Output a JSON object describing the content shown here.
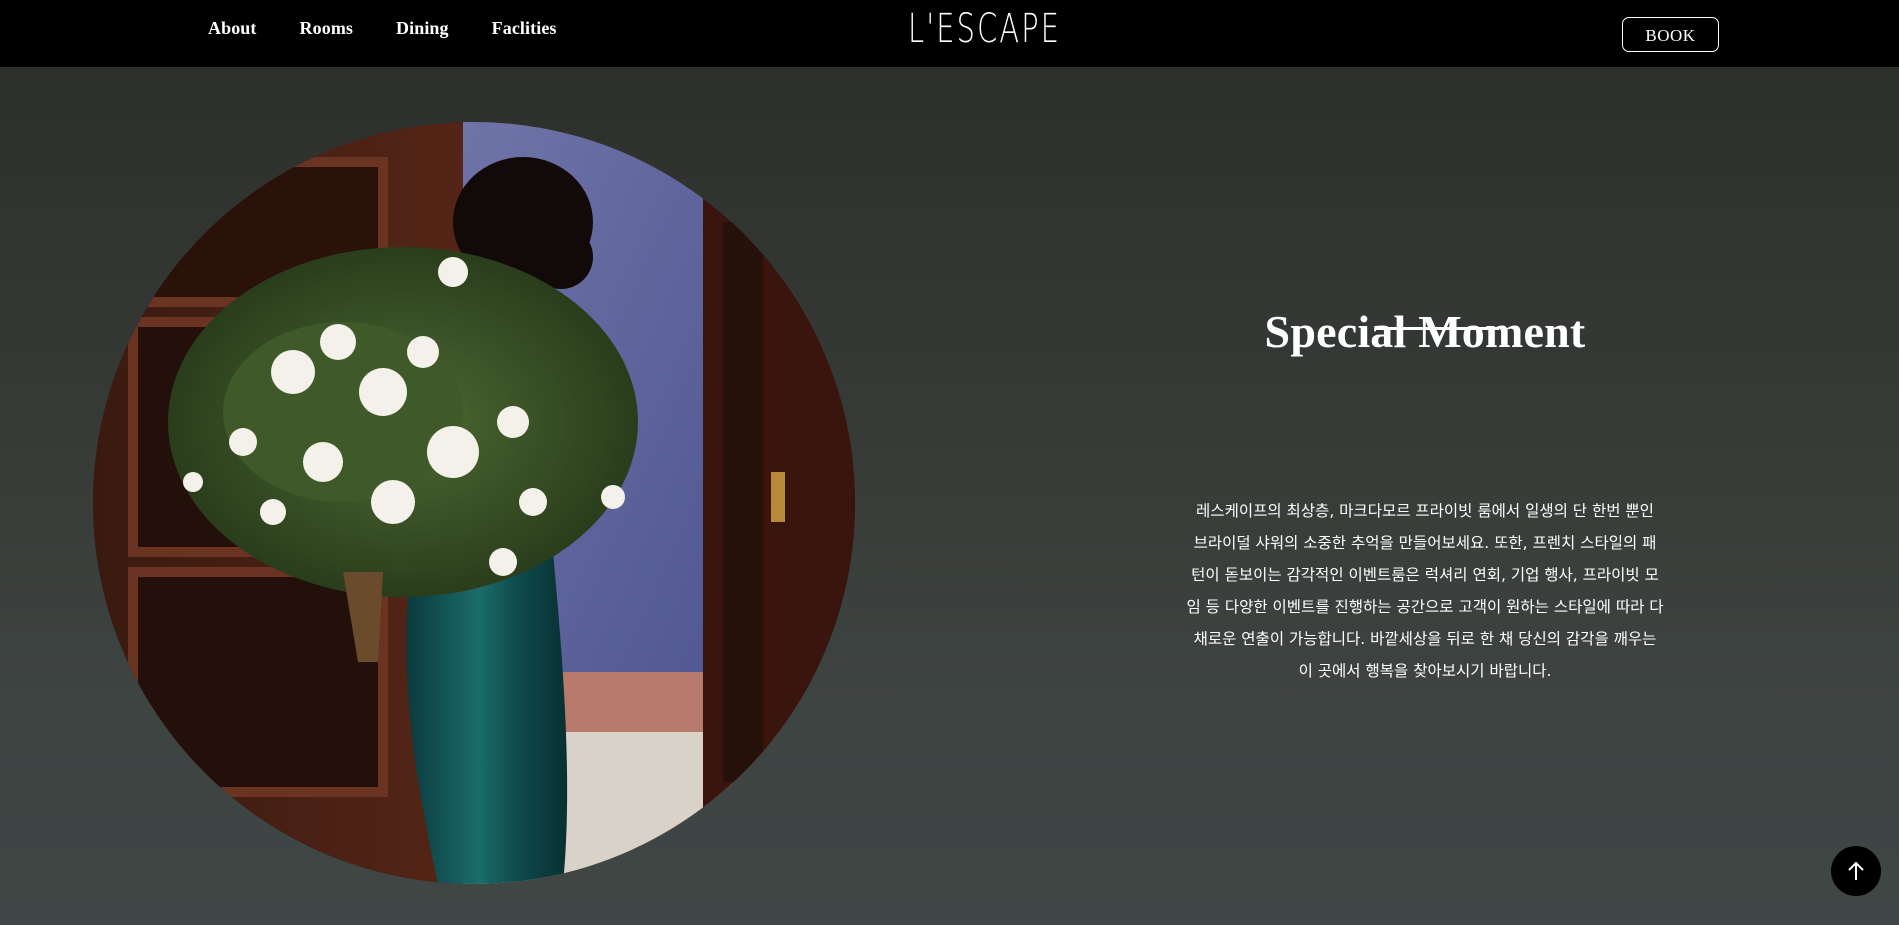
{
  "header": {
    "nav": [
      "About",
      "Rooms",
      "Dining",
      "Faclities"
    ],
    "logo": "L'ESCAPE",
    "book_label": "BOOK"
  },
  "main": {
    "photo_alt": "woman-with-bouquet-photo",
    "title": "Special Moment",
    "description_lines": [
      "레스케이프의 최상층, 마크다모르 프라이빗 룸에서 일생의 단 한번 뿐인",
      "브라이덜 샤워의 소중한 추억을 만들어보세요. 또한, 프렌치 스타일의 패",
      "턴이 돋보이는 감각적인 이벤트룸은 럭셔리 연회, 기업 행사, 프라이빗 모",
      "임 등 다양한 이벤트를 진행하는 공간으로 고객이 원하는 스타일에 따라 다",
      "채로운 연출이 가능합니다. 바깥세상을 뒤로 한 채 당신의 감각을 깨우는",
      "이 곳에서 행복을 찾아보시기 바랍니다."
    ]
  },
  "scroll_top": {
    "icon": "arrow-up-icon"
  },
  "colors": {
    "header_bg": "#000000",
    "section_bg_top": "#2d2f2b",
    "section_bg_bottom": "#3f4645",
    "text": "#ffffff"
  }
}
